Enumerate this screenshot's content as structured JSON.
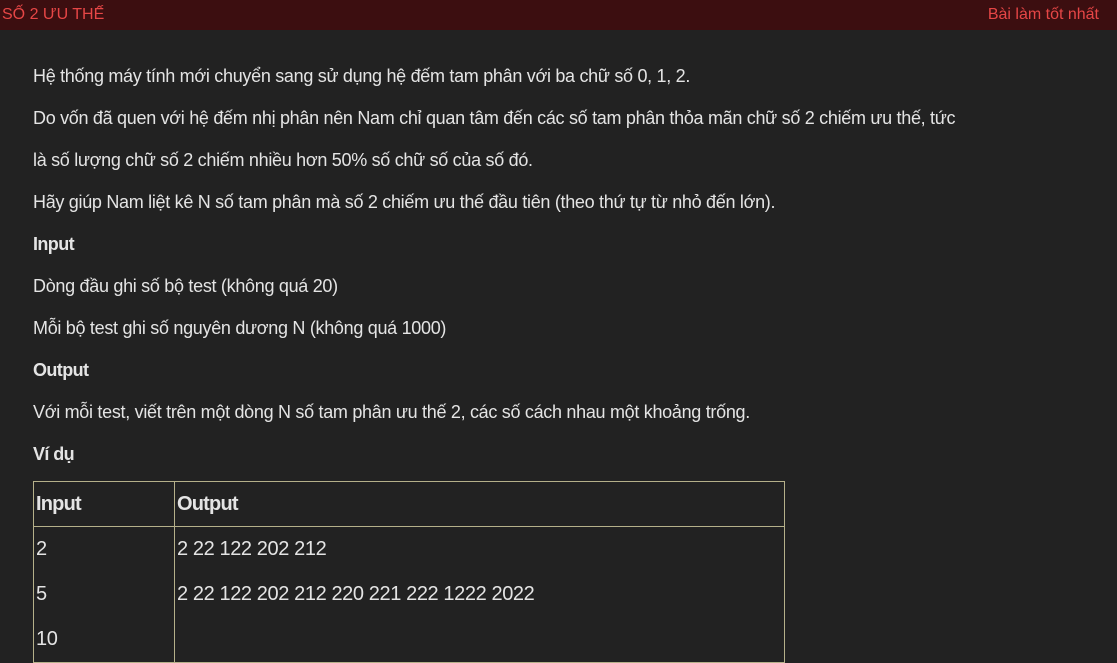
{
  "header": {
    "title": "SỐ 2 ƯU THẾ",
    "best_link": "Bài làm tốt nhất"
  },
  "problem": {
    "para1": "Hệ thống máy tính mới chuyển sang sử dụng hệ đếm tam phân với ba chữ số 0, 1, 2.",
    "para2_line1": "Do vốn đã quen với hệ đếm nhị phân nên Nam chỉ quan tâm đến các số tam phân thỏa mãn chữ số 2 chiếm ưu thế, tức",
    "para2_line2": "là số lượng chữ số 2 chiếm nhiều hơn 50% số chữ số của số đó.",
    "para3": "Hãy giúp Nam liệt kê N số tam phân mà số 2 chiếm ưu thế đầu tiên (theo thứ tự từ nhỏ đến lớn).",
    "input_heading": "Input",
    "input_line1": "Dòng đầu ghi số bộ test (không quá 20)",
    "input_line2": "Mỗi bộ test ghi số nguyên dương N (không quá 1000)",
    "output_heading": "Output",
    "output_line1": "Với mỗi test, viết trên một dòng N số tam phân ưu thế 2, các số cách nhau một khoảng trống.",
    "example_heading": "Ví dụ"
  },
  "example_table": {
    "headers": [
      "Input",
      "Output"
    ],
    "inputs": [
      "2",
      "5",
      "10"
    ],
    "outputs": [
      "2 22 122 202 212",
      "2 22 122 202 212 220 221 222 1222 2022"
    ]
  }
}
